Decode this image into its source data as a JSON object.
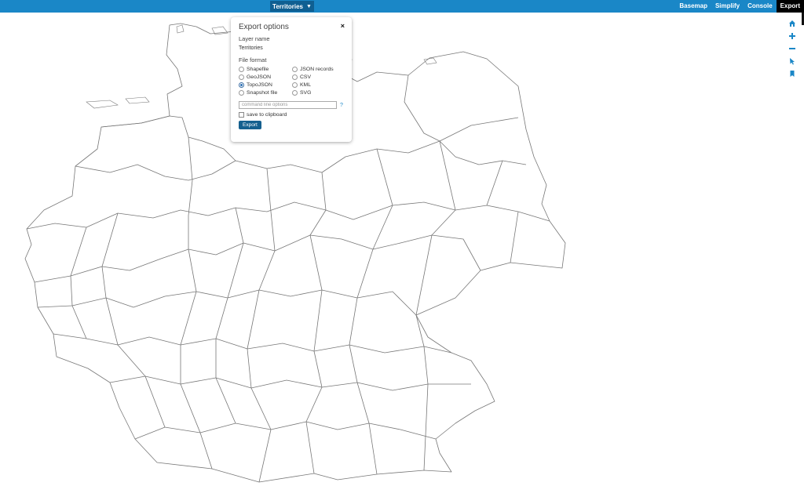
{
  "header": {
    "layer_selector": "Territories",
    "nav": [
      "Basemap",
      "Simplify",
      "Console",
      "Export"
    ],
    "active_nav": "Export"
  },
  "tools": [
    "home-icon",
    "zoom-in-icon",
    "zoom-out-icon",
    "pointer-icon",
    "bookmark-icon"
  ],
  "export_panel": {
    "title": "Export options",
    "close": "×",
    "layer_name_label": "Layer name",
    "layer_name": "Territories",
    "file_format_label": "File format",
    "formats": [
      {
        "label": "Shapefile",
        "selected": false
      },
      {
        "label": "JSON records",
        "selected": false
      },
      {
        "label": "GeoJSON",
        "selected": false
      },
      {
        "label": "CSV",
        "selected": false
      },
      {
        "label": "TopoJSON",
        "selected": true
      },
      {
        "label": "KML",
        "selected": false
      },
      {
        "label": "Snapshot file",
        "selected": false
      },
      {
        "label": "SVG",
        "selected": false
      }
    ],
    "cmd_placeholder": "command line options",
    "help": "?",
    "clipboard_label": "save to clipboard",
    "clipboard_checked": false,
    "export_button": "Export"
  },
  "colors": {
    "topbar": "#1a87c7",
    "layer_menu": "#0f5f92",
    "accent": "#1a87c7",
    "button": "#15608f",
    "map_stroke": "#777777"
  }
}
